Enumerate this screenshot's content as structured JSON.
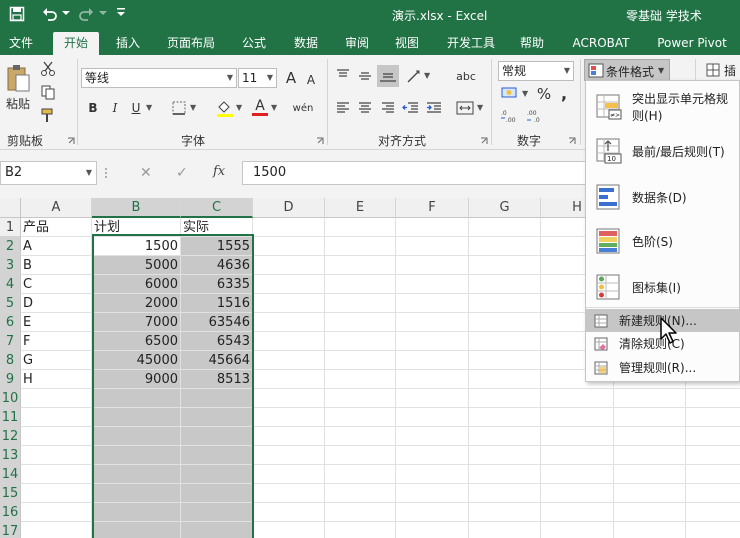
{
  "titlebar": {
    "doc_title": "演示.xlsx  -  Excel",
    "right_text": "零基础 学技术"
  },
  "tabs": [
    "文件",
    "开始",
    "插入",
    "页面布局",
    "公式",
    "数据",
    "审阅",
    "视图",
    "开发工具",
    "帮助",
    "ACROBAT",
    "Power Pivot"
  ],
  "ribbon": {
    "paste_label": "粘贴",
    "clipboard_label": "剪贴板",
    "font_name": "等线",
    "font_size": "11",
    "font_group_label": "字体",
    "align_group_label": "对齐方式",
    "number_format": "常规",
    "number_group_label": "数字",
    "cond_format_label": "条件格式",
    "insert_label": "插",
    "bold": "B",
    "italic": "I",
    "underline": "U",
    "grow_font": "A",
    "shrink_font": "A",
    "font_color": "A",
    "wrap_text": "abc",
    "phonetic": "wén",
    "percent": "%",
    "comma": ","
  },
  "formula_bar": {
    "name_box": "B2",
    "cancel": "✕",
    "enter": "✓",
    "fx": "fx",
    "value": "1500"
  },
  "sheet": {
    "columns": [
      "A",
      "B",
      "C",
      "D",
      "E",
      "F",
      "G",
      "H"
    ],
    "row_numbers": [
      "1",
      "2",
      "3",
      "4",
      "5",
      "6",
      "7",
      "8",
      "9",
      "10",
      "11",
      "12",
      "13",
      "14",
      "15",
      "16",
      "17"
    ],
    "headers": [
      "产品",
      "计划",
      "实际"
    ],
    "rows": [
      [
        "A",
        "1500",
        "1555"
      ],
      [
        "B",
        "5000",
        "4636"
      ],
      [
        "C",
        "6000",
        "6335"
      ],
      [
        "D",
        "2000",
        "1516"
      ],
      [
        "E",
        "7000",
        "63546"
      ],
      [
        "F",
        "6500",
        "6543"
      ],
      [
        "G",
        "45000",
        "45664"
      ],
      [
        "H",
        "9000",
        "8513"
      ]
    ]
  },
  "menu": {
    "items": [
      "突出显示单元格规则(H)",
      "最前/最后规则(T)",
      "数据条(D)",
      "色阶(S)",
      "图标集(I)",
      "新建规则(N)...",
      "清除规则(C)",
      "管理规则(R)..."
    ]
  },
  "colors": {
    "excel_green": "#217346",
    "selection_shade": "#c8c8c8",
    "menu_highlight": "#c6c6c6"
  }
}
